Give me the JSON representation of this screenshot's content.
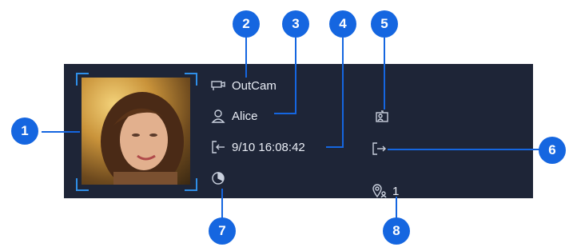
{
  "record": {
    "camera_name": "OutCam",
    "person_name": "Alice",
    "datetime": "9/10 16:08:42",
    "count": "1"
  },
  "callouts": [
    "1",
    "2",
    "3",
    "4",
    "5",
    "6",
    "7",
    "8"
  ],
  "icons": {
    "camera": "camera-icon",
    "person": "user-icon",
    "entry": "entry-icon",
    "id_card": "id-card-icon",
    "exit": "exit-icon",
    "duration": "clock-icon",
    "location_person": "location-person-icon"
  },
  "colors": {
    "panel": "#1e2537",
    "callout": "#1566e0",
    "frame": "#2f8fe8"
  }
}
